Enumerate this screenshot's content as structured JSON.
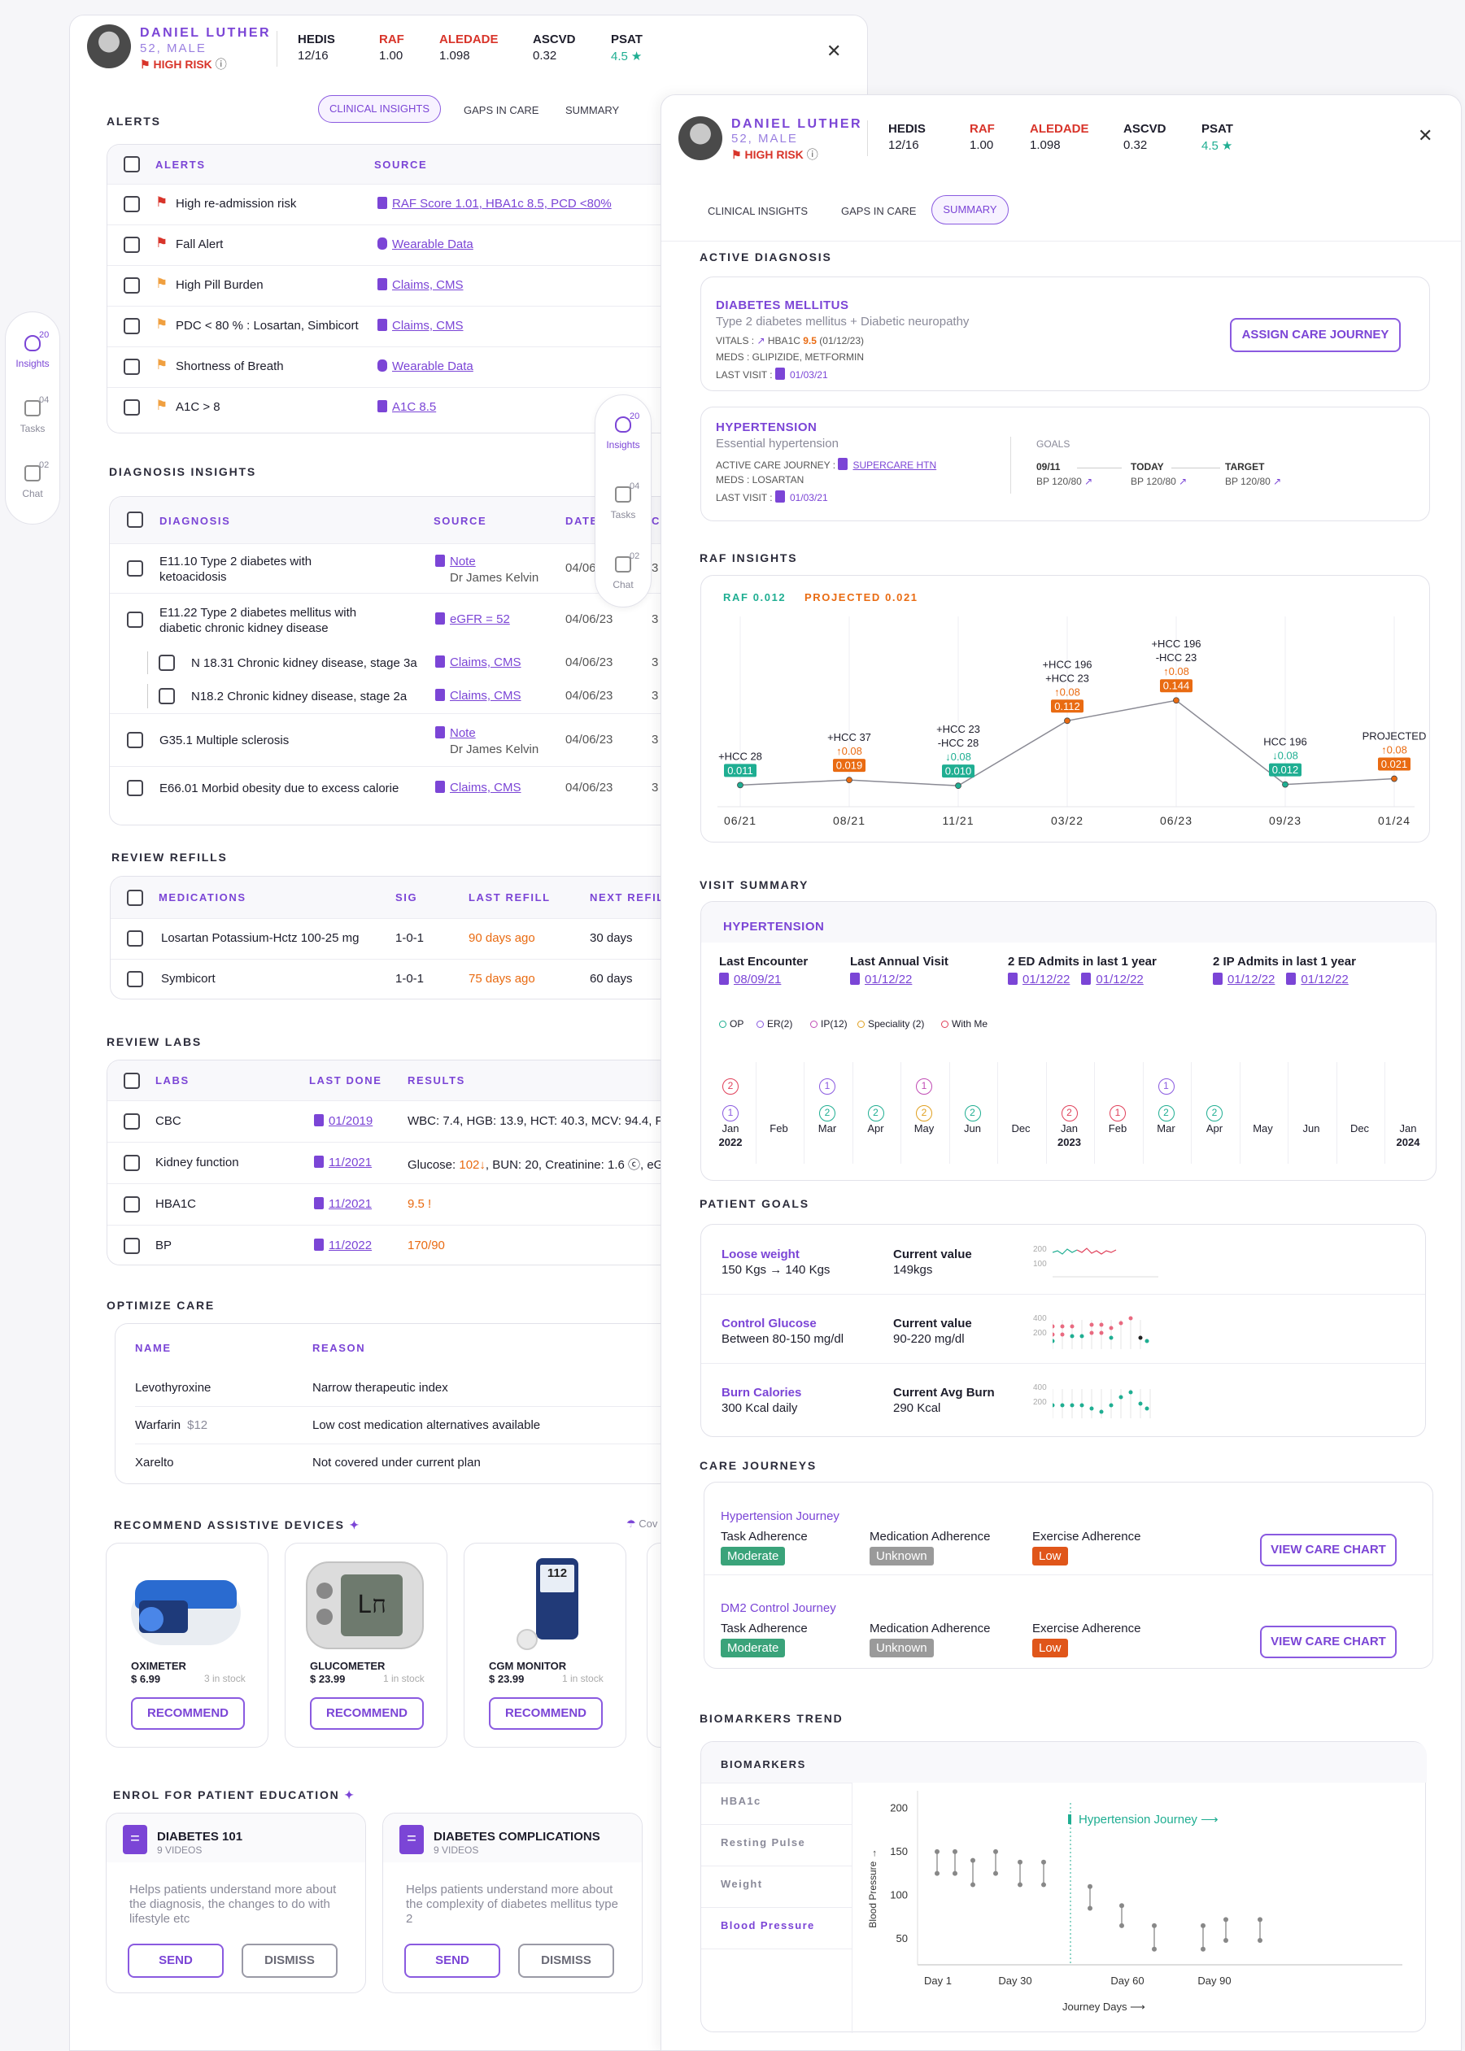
{
  "patient": {
    "name": "DANIEL LUTHER",
    "age_sex": "52, MALE",
    "risk": "HIGH RISK"
  },
  "metrics": [
    {
      "label": "HEDIS",
      "value": "12/16",
      "color": "#1d1d2b"
    },
    {
      "label": "RAF",
      "value": "1.00",
      "color": "#d8342a"
    },
    {
      "label": "ALEDADE",
      "value": "1.098",
      "color": "#d8342a"
    },
    {
      "label": "ASCVD",
      "value": "0.32",
      "color": "#1d1d2b"
    },
    {
      "label": "PSAT",
      "value": "4.5",
      "color": "#1d1d2b"
    }
  ],
  "tabs": {
    "clinical": "CLINICAL INSIGHTS",
    "gaps": "GAPS IN CARE",
    "summary": "SUMMARY"
  },
  "rail": {
    "insights": {
      "label": "Insights",
      "count": "20"
    },
    "tasks": {
      "label": "Tasks",
      "count": "04"
    },
    "chat": {
      "label": "Chat",
      "count": "02"
    }
  },
  "alerts": {
    "title": "ALERTS",
    "col_alerts": "ALERTS",
    "col_source": "SOURCE",
    "rows": [
      {
        "text": "High re-admission risk",
        "source": "RAF Score 1.01,  HBA1c 8.5, PCD <80%",
        "flag": "red",
        "icon": "doc-icon"
      },
      {
        "text": "Fall Alert",
        "source": "Wearable Data",
        "flag": "red",
        "icon": "watch-icon"
      },
      {
        "text": "High Pill Burden",
        "source": "Claims, CMS",
        "flag": "orange",
        "icon": "doc-icon"
      },
      {
        "text": "PDC < 80 % : Losartan, Simbicort",
        "source": "Claims, CMS",
        "flag": "orange",
        "icon": "doc-icon"
      },
      {
        "text": "Shortness of Breath",
        "source": "Wearable Data",
        "flag": "orange",
        "icon": "watch-icon"
      },
      {
        "text": "A1C > 8",
        "source": "A1C 8.5",
        "flag": "orange",
        "icon": "doc-icon"
      }
    ]
  },
  "diagnosis": {
    "title": "DIAGNOSIS INSIGHTS",
    "col_diag": "DIAGNOSIS",
    "col_source": "SOURCE",
    "col_date": "DATE",
    "col_extra": "C",
    "rows": [
      {
        "text": "E11.10 Type 2 diabetes with\nketoacidosis",
        "source": "Note",
        "sub": "Dr James Kelvin",
        "date": "04/06/23",
        "extra": "3"
      },
      {
        "text": "E11.22 Type 2 diabetes mellitus with\ndiabetic chronic kidney disease",
        "source": "eGFR = 52",
        "sub": "",
        "date": "04/06/23",
        "extra": "3"
      },
      {
        "text": "N 18.31 Chronic kidney disease, stage 3a",
        "source": "Claims, CMS",
        "sub": "",
        "date": "04/06/23",
        "extra": "3"
      },
      {
        "text": "N18.2 Chronic kidney disease, stage 2a",
        "source": "Claims, CMS",
        "sub": "",
        "date": "04/06/23",
        "extra": "3"
      },
      {
        "text": "G35.1 Multiple sclerosis",
        "source": "Note",
        "sub": "Dr James Kelvin",
        "date": "04/06/23",
        "extra": "3"
      },
      {
        "text": "E66.01 Morbid obesity due to excess calorie",
        "source": "Claims, CMS",
        "sub": "",
        "date": "04/06/23",
        "extra": "3"
      }
    ]
  },
  "refills": {
    "title": "REVIEW  REFILLS",
    "cols": [
      "MEDICATIONS",
      "SIG",
      "LAST REFILL",
      "NEXT REFIL"
    ],
    "rows": [
      {
        "med": "Losartan Potassium-Hctz 100-25 mg",
        "sig": "1-0-1",
        "last": "90 days ago",
        "next": "30 days"
      },
      {
        "med": "Symbicort",
        "sig": "1-0-1",
        "last": "75 days ago",
        "next": "60 days"
      }
    ]
  },
  "labs": {
    "title": "REVIEW LABS",
    "cols": [
      "LABS",
      "LAST DONE",
      "RESULTS"
    ],
    "rows": [
      {
        "lab": "CBC",
        "date": "01/2019",
        "pre": "WBC: 7.4, HGB: 13.9, HCT: 40.3, MCV: 94.4, PL",
        "hi": "",
        "post": ""
      },
      {
        "lab": "Kidney function",
        "date": "11/2021",
        "pre": "Glucose: ",
        "hi": "102↓",
        "post": ", BUN: 20, Creatinine: 1.6 ⓒ, eG"
      },
      {
        "lab": "HBA1C",
        "date": "11/2021",
        "pre": "",
        "hi": "9.5 !",
        "post": ""
      },
      {
        "lab": "BP",
        "date": "11/2022",
        "pre": "",
        "hi": "170/90",
        "post": ""
      }
    ]
  },
  "optimize": {
    "title": "OPTIMIZE CARE",
    "cols": [
      "NAME",
      "REASON"
    ],
    "rows": [
      {
        "name": "Levothyroxine",
        "price": "",
        "reason": "Narrow therapeutic index"
      },
      {
        "name": "Warfarin",
        "price": "$12",
        "reason": "Low cost medication alternatives available"
      },
      {
        "name": "Xarelto",
        "price": "",
        "reason": "Not covered under current plan"
      }
    ]
  },
  "devices": {
    "title": "RECOMMEND ASSISTIVE DEVICES",
    "cov": "Cov",
    "items": [
      {
        "name": "OXIMETER",
        "price": "$ 6.99",
        "stock": "3 in stock",
        "btn": "RECOMMEND"
      },
      {
        "name": "GLUCOMETER",
        "price": "$ 23.99",
        "stock": "1 in stock",
        "btn": "RECOMMEND"
      },
      {
        "name": "CGM MONITOR",
        "price": "$ 23.99",
        "stock": "1 in stock",
        "btn": "RECOMMEND"
      }
    ],
    "glucometer_reading": "112"
  },
  "education": {
    "title": "ENROL FOR PATIENT EDUCATION",
    "items": [
      {
        "name": "DIABETES 101",
        "videos": "9 VIDEOS",
        "desc": "Helps patients understand more about the diagnosis, the changes to do with lifestyle etc",
        "send": "SEND",
        "dismiss": "DISMISS"
      },
      {
        "name": "DIABETES COMPLICATIONS",
        "videos": "9 VIDEOS",
        "desc": "Helps patients understand more about the complexity of diabetes mellitus type 2",
        "send": "SEND",
        "dismiss": "DISMISS"
      }
    ]
  },
  "active_diag": {
    "title": "ACTIVE DIAGNOSIS",
    "diabetes": {
      "name": "DIABETES MELLITUS",
      "desc": "Type 2 diabetes mellitus + Diabetic neuropathy",
      "vitals_label": "VITALS :",
      "vitals_item": "HBA1C",
      "vitals_value": "9.5",
      "vitals_date": "(01/12/23)",
      "meds": "MEDS : GLIPIZIDE, METFORMIN",
      "visit_label": "LAST VISIT :",
      "visit_date": "01/03/21",
      "btn": "ASSIGN CARE JOURNEY"
    },
    "htn": {
      "name": "HYPERTENSION",
      "desc": "Essential hypertension",
      "journey_label": "ACTIVE CARE JOURNEY :",
      "journey": "SUPERCARE HTN",
      "meds": "MEDS : LOSARTAN",
      "visit_label": "LAST VISIT :",
      "visit_date": "01/03/21",
      "goals_label": "GOALS",
      "goals": [
        {
          "label": "09/11",
          "value": "BP 120/80"
        },
        {
          "label": "TODAY",
          "value": "BP 120/80"
        },
        {
          "label": "TARGET",
          "value": "BP 120/80"
        }
      ]
    }
  },
  "raf": {
    "title": "RAF INSIGHTS",
    "raf_label": "RAF 0.012",
    "projected_label": "PROJECTED 0.021"
  },
  "chart_data": {
    "type": "line",
    "x": [
      "06/21",
      "08/21",
      "11/21",
      "03/22",
      "06/23",
      "09/23",
      "01/24"
    ],
    "series": [
      {
        "name": "RAF",
        "values": [
          0.011,
          0.019,
          0.01,
          0.112,
          0.144,
          0.012,
          0.021
        ]
      }
    ],
    "annotations": [
      {
        "lines": [
          "+HCC 28"
        ],
        "delta": "",
        "dir": "",
        "value": "0.011",
        "color": "#1fae92"
      },
      {
        "lines": [
          "+HCC 37"
        ],
        "delta": "0.08",
        "dir": "up",
        "value": "0.019",
        "color": "#e96b12"
      },
      {
        "lines": [
          "+HCC 23",
          "-HCC 28"
        ],
        "delta": "0.08",
        "dir": "down",
        "value": "0.010",
        "color": "#1fae92"
      },
      {
        "lines": [
          "+HCC 196",
          "+HCC 23"
        ],
        "delta": "0.08",
        "dir": "up",
        "value": "0.112",
        "color": "#e96b12"
      },
      {
        "lines": [
          "+HCC 196",
          "-HCC 23"
        ],
        "delta": "0.08",
        "dir": "up",
        "value": "0.144",
        "color": "#e96b12"
      },
      {
        "lines": [
          "HCC 196"
        ],
        "delta": "0.08",
        "dir": "down",
        "value": "0.012",
        "color": "#1fae92"
      },
      {
        "lines": [
          "PROJECTED"
        ],
        "delta": "0.08",
        "dir": "up",
        "value": "0.021",
        "color": "#e96b12"
      }
    ]
  },
  "visit": {
    "title": "VISIT SUMMARY",
    "condition": "HYPERTENSION",
    "stats": [
      {
        "label": "Last Encounter",
        "links": [
          "08/09/21"
        ]
      },
      {
        "label": "Last Annual Visit",
        "links": [
          "01/12/22"
        ]
      },
      {
        "label": "2 ED Admits in last 1 year",
        "links": [
          "01/12/22",
          "01/12/22"
        ]
      },
      {
        "label": "2 IP Admits in last 1 year",
        "links": [
          "01/12/22",
          "01/12/22"
        ]
      }
    ],
    "legend": [
      {
        "label": "OP",
        "color": "#1fae92"
      },
      {
        "label": "ER(2)",
        "color": "#8a5ae0"
      },
      {
        "label": "IP(12)",
        "color": "#c04bb4"
      },
      {
        "label": "Speciality (2)",
        "color": "#e0a020"
      },
      {
        "label": "With Me",
        "color": "#e0405a"
      }
    ],
    "months": [
      {
        "m": "Jan",
        "y": "2022",
        "dots": [
          [
            "2",
            "#e0405a"
          ],
          [
            "1",
            "#8a5ae0"
          ]
        ]
      },
      {
        "m": "Feb",
        "y": "",
        "dots": []
      },
      {
        "m": "Mar",
        "y": "",
        "dots": [
          [
            "1",
            "#8a5ae0"
          ],
          [
            "2",
            "#1fae92"
          ]
        ]
      },
      {
        "m": "Apr",
        "y": "",
        "dots": [
          [
            "2",
            "#1fae92"
          ]
        ]
      },
      {
        "m": "May",
        "y": "",
        "dots": [
          [
            "1",
            "#c04bb4"
          ],
          [
            "2",
            "#e0a020"
          ]
        ]
      },
      {
        "m": "Jun",
        "y": "",
        "dots": [
          [
            "2",
            "#1fae92"
          ]
        ]
      },
      {
        "m": "Dec",
        "y": "",
        "dots": []
      },
      {
        "m": "Jan",
        "y": "2023",
        "dots": [
          [
            "2",
            "#e0405a"
          ]
        ]
      },
      {
        "m": "Feb",
        "y": "",
        "dots": [
          [
            "1",
            "#e0405a"
          ]
        ]
      },
      {
        "m": "Mar",
        "y": "",
        "dots": [
          [
            "1",
            "#8a5ae0"
          ],
          [
            "2",
            "#1fae92"
          ]
        ]
      },
      {
        "m": "Apr",
        "y": "",
        "dots": [
          [
            "2",
            "#1fae92"
          ]
        ]
      },
      {
        "m": "May",
        "y": "",
        "dots": []
      },
      {
        "m": "Jun",
        "y": "",
        "dots": []
      },
      {
        "m": "Dec",
        "y": "",
        "dots": []
      },
      {
        "m": "Jan",
        "y": "2024",
        "dots": []
      }
    ]
  },
  "goals": {
    "title": "PATIENT GOALS",
    "rows": [
      {
        "name": "Loose weight",
        "target": "150 Kgs  → 140 Kgs",
        "cv_label": "Current value",
        "cv": "149kgs",
        "ticks": [
          "200",
          "100"
        ]
      },
      {
        "name": "Control Glucose",
        "target": "Between 80-150 mg/dl",
        "cv_label": "Current value",
        "cv": "90-220 mg/dl",
        "ticks": [
          "400",
          "200"
        ]
      },
      {
        "name": "Burn Calories",
        "target": "300 Kcal daily",
        "cv_label": "Current Avg Burn",
        "cv": "290 Kcal",
        "ticks": [
          "400",
          "200"
        ]
      }
    ]
  },
  "journeys": {
    "title": "CARE JOURNEYS",
    "items": [
      {
        "name": "Hypertension Journey",
        "task": "Task Adherence",
        "task_v": "Moderate",
        "med": "Medication Adherence",
        "med_v": "Unknown",
        "ex": "Exercise Adherence",
        "ex_v": "Low",
        "btn": "VIEW CARE CHART"
      },
      {
        "name": "DM2 Control Journey",
        "task": "Task Adherence",
        "task_v": "Moderate",
        "med": "Medication Adherence",
        "med_v": "Unknown",
        "ex": "Exercise Adherence",
        "ex_v": "Low",
        "btn": "VIEW CARE CHART"
      }
    ]
  },
  "biomarkers": {
    "title": "BIOMARKERS TREND",
    "header": "BIOMARKERS",
    "items": [
      "HBA1c",
      "Resting Pulse",
      "Weight",
      "Blood Pressure"
    ],
    "journey_marker": "Hypertension Journey",
    "y_label": "Blood Pressure",
    "x_label": "Journey Days",
    "y_ticks": [
      "200",
      "150",
      "100",
      "50"
    ],
    "x_ticks": [
      "Day 1",
      "Day 30",
      "Day 60",
      "Day 90"
    ],
    "bp": [
      [
        150,
        125
      ],
      [
        150,
        125
      ],
      [
        140,
        112
      ],
      [
        150,
        125
      ],
      [
        138,
        112
      ],
      [
        138,
        112
      ],
      [
        110,
        85
      ],
      [
        88,
        65
      ],
      [
        65,
        38
      ],
      [
        65,
        38
      ],
      [
        72,
        48
      ],
      [
        72,
        48
      ]
    ]
  }
}
